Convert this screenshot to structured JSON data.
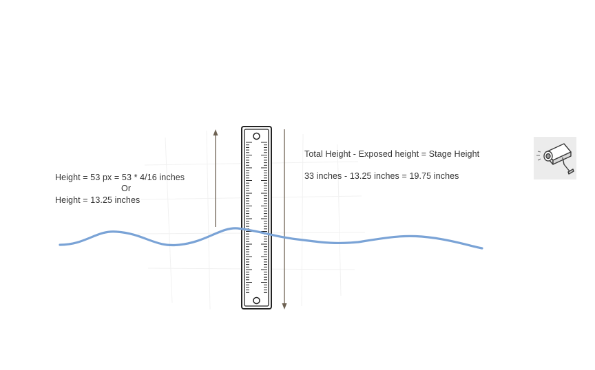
{
  "left_annotation": {
    "line1": "Height = 53 px = 53 * 4/16 inches",
    "or": "Or",
    "line2": "Height = 13.25 inches"
  },
  "right_annotation": {
    "line1": "Total Height - Exposed height = Stage Height",
    "line2": "33 inches -  13.25 inches = 19.75 inches"
  },
  "icons": {
    "camera": "security-camera-icon",
    "ruler": "staff-gauge-icon"
  },
  "colors": {
    "water_line": "#7aa3d6",
    "arrows": "#6e6253",
    "ruler_stroke": "#222222",
    "text": "#333333"
  }
}
